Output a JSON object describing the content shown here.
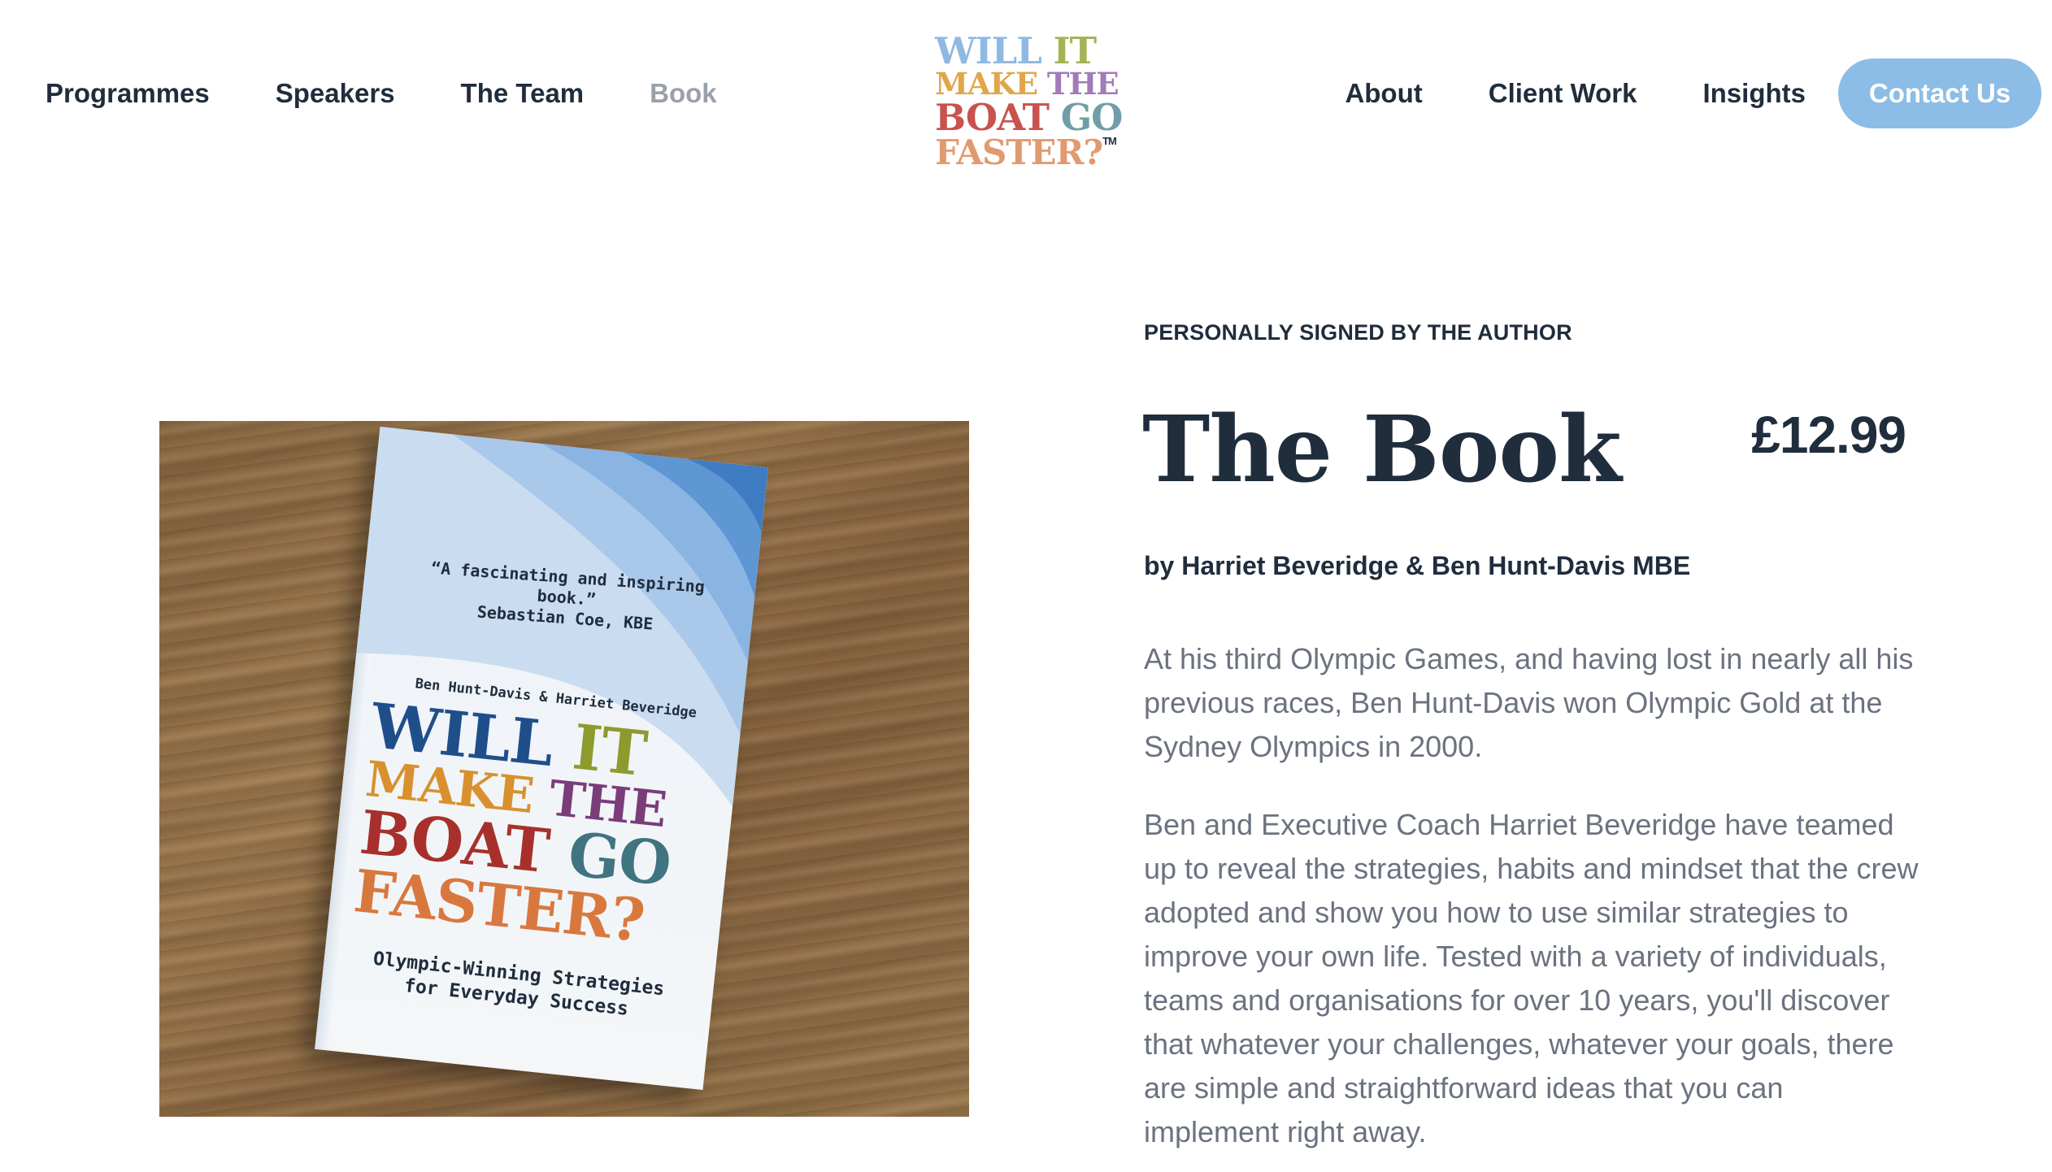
{
  "nav": {
    "left": [
      "Programmes",
      "Speakers",
      "The Team",
      "Book"
    ],
    "active": "Book",
    "right": [
      "About",
      "Client Work",
      "Insights"
    ],
    "contact_label": "Contact Us",
    "accent_color": "#8cbde6"
  },
  "logo": {
    "line1": [
      "WILL",
      "IT"
    ],
    "line2": [
      "MAKE",
      "THE"
    ],
    "line3": [
      "BOAT",
      "GO"
    ],
    "line4": "FASTER?",
    "trademark": "TM",
    "colors": [
      "#8fb9e3",
      "#a3b355",
      "#e0a64a",
      "#a27bb8",
      "#c9524e",
      "#6f9ea7",
      "#e19a6f"
    ]
  },
  "book_cover": {
    "quote": "“A fascinating and inspiring book.”",
    "quote_author": "Sebastian Coe, KBE",
    "authors": "Ben Hunt-Davis & Harriet Beveridge",
    "title_line1": [
      "WILL",
      "IT"
    ],
    "title_line2": [
      "MAKE",
      "THE"
    ],
    "title_line3": [
      "BOAT",
      "GO"
    ],
    "title_line4": "FASTER?",
    "subtitle_line1": "Olympic-Winning Strategies",
    "subtitle_line2": "for Everyday Success"
  },
  "product": {
    "eyebrow": "PERSONALLY SIGNED BY THE AUTHOR",
    "title": "The Book",
    "price": "£12.99",
    "byline": "by Harriet Beveridge & Ben Hunt-Davis MBE",
    "description": [
      "At his third Olympic Games, and having lost in nearly all his previous races, Ben Hunt-Davis won Olympic Gold at the Sydney Olympics in 2000.",
      "Ben and Executive Coach Harriet Beveridge have teamed up to reveal the strategies, habits and mindset that the crew adopted and show you how to use similar strategies to improve your own life. Tested with a variety of individuals, teams and organisations for over 10 years, you'll discover that whatever your challenges, whatever your goals, there are simple and straightforward ideas that you can implement right away."
    ]
  }
}
